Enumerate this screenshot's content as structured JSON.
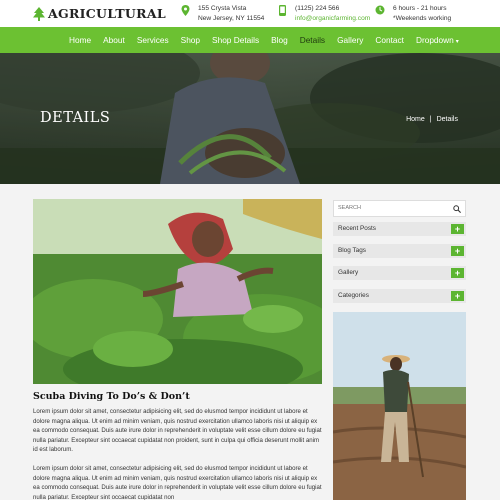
{
  "header": {
    "logo_text": "AGRICULTURAL",
    "address": [
      "155 Crysta Vista",
      "New Jersey, NY 11554"
    ],
    "contact": [
      "(1125) 224 566",
      "info@organicfarming.com"
    ],
    "hours": [
      "6 hours - 21 hours",
      "*Weekends working"
    ],
    "icons": [
      "location-pin-icon",
      "phone-icon",
      "clock-icon"
    ]
  },
  "nav": {
    "items": [
      "Home",
      "About",
      "Services",
      "Shop",
      "Shop Details",
      "Blog",
      "Details",
      "Gallery",
      "Contact",
      "Dropdown"
    ],
    "active": "Details",
    "dropdown_caret": "▾"
  },
  "hero": {
    "title": "DETAILS",
    "breadcrumb": [
      "Home",
      "|",
      "Details"
    ]
  },
  "post": {
    "title": "Scuba Diving To Do’s & Don’t",
    "paragraphs": [
      "Lorem ipsum dolor sit amet, consectetur adipisicing elit, sed do elusmod tempor incididunt ut labore et dolore magna aliqua. Ut enim ad minim veniam, quis nostrud exercitation ullamco laboris nisi ut aliquip ex ea commodo consequat. Duis aute irure dolor in reprehenderit in voluptate velit esse cillum dolore eu fugiat nulla pariatur. Excepteur sint occaecat cupidatat non proident, sunt in culpa qui officia deserunt mollit anim id est laborum.",
      "Lorem ipsum dolor sit amet, consectetur adipisicing elit, sed do elusmod tempor incididunt ut labore et dolore magna aliqua. Ut enim ad minim veniam, quis nostrud exercitation ullamco laboris nisi ut aliquip ex ea commodo consequat. Duis aute irure dolor in reprehenderit in voluptate velit esse cillum dolore eu fugiat nulla pariatur. Excepteur sint occaecat cupidatat non"
    ]
  },
  "sidebar": {
    "search_placeholder": "SEARCH",
    "widgets": [
      "Recent Posts",
      "Blog Tags",
      "Gallery",
      "Categories"
    ],
    "plus_label": "+"
  },
  "colors": {
    "accent": "#6cc132",
    "accent_dark": "#5cb531"
  }
}
